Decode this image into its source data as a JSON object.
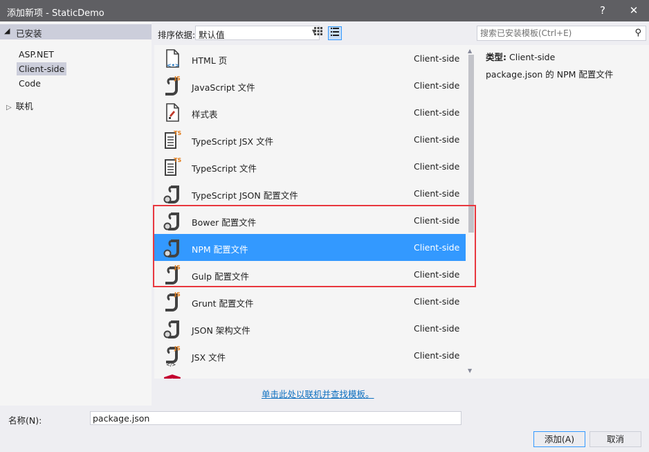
{
  "window": {
    "title": "添加新项 - StaticDemo",
    "help_label": "?",
    "close_label": "✕"
  },
  "sidebar": {
    "installed_label": "已安装",
    "items": [
      {
        "label": "ASP.NET"
      },
      {
        "label": "Client-side"
      },
      {
        "label": "Code"
      }
    ],
    "online_label": "联机"
  },
  "toolbar": {
    "sort_label": "排序依据:",
    "sort_value": "默认值",
    "search_placeholder": "搜索已安装模板(Ctrl+E)"
  },
  "templates": [
    {
      "name": "HTML 页",
      "category": "Client-side",
      "icon": "html-file-icon"
    },
    {
      "name": "JavaScript 文件",
      "category": "Client-side",
      "icon": "javascript-file-icon"
    },
    {
      "name": "样式表",
      "category": "Client-side",
      "icon": "stylesheet-file-icon"
    },
    {
      "name": "TypeScript JSX 文件",
      "category": "Client-side",
      "icon": "typescript-file-icon"
    },
    {
      "name": "TypeScript 文件",
      "category": "Client-side",
      "icon": "typescript-file-icon"
    },
    {
      "name": "TypeScript JSON 配置文件",
      "category": "Client-side",
      "icon": "json-config-icon"
    },
    {
      "name": "Bower 配置文件",
      "category": "Client-side",
      "icon": "json-config-icon"
    },
    {
      "name": "NPM 配置文件",
      "category": "Client-side",
      "icon": "json-config-icon",
      "selected": true
    },
    {
      "name": "Gulp 配置文件",
      "category": "Client-side",
      "icon": "javascript-file-icon"
    },
    {
      "name": "Grunt 配置文件",
      "category": "Client-side",
      "icon": "javascript-file-icon"
    },
    {
      "name": "JSON 架构文件",
      "category": "Client-side",
      "icon": "json-config-icon"
    },
    {
      "name": "JSX 文件",
      "category": "Client-side",
      "icon": "jsx-file-icon"
    },
    {
      "name": "",
      "category": "",
      "icon": "angular-icon"
    }
  ],
  "details": {
    "type_label": "类型:",
    "type_value": "Client-side",
    "description": "package.json 的 NPM 配置文件"
  },
  "online_link": "单击此处以联机并查找模板。",
  "name_field": {
    "label": "名称(N):",
    "value": "package.json"
  },
  "buttons": {
    "add": "添加(A)",
    "cancel": "取消"
  },
  "colors": {
    "titlebar": "#5f5f63",
    "selection": "#3399ff",
    "highlight_box": "#e8373e",
    "link": "#0e70c0"
  }
}
